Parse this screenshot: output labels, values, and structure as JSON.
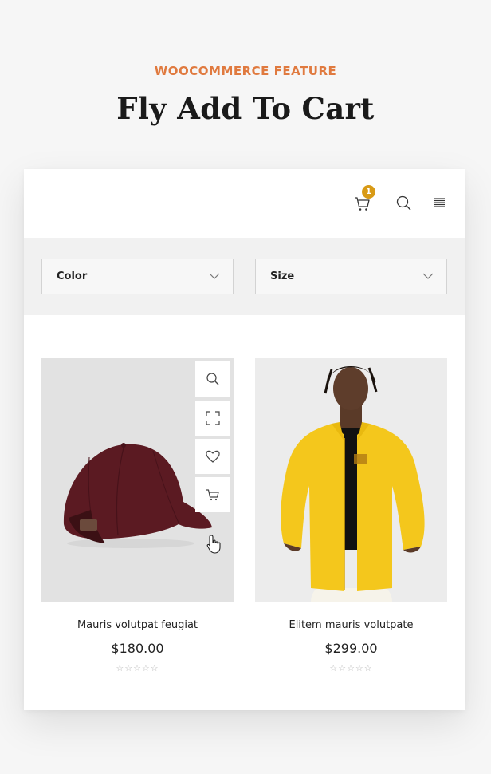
{
  "header": {
    "eyebrow": "WOOCOMMERCE FEATURE",
    "title": "Fly Add To Cart"
  },
  "topbar": {
    "cart_count": "1",
    "icons": [
      "cart-icon",
      "search-icon",
      "menu-icon"
    ]
  },
  "filters": {
    "color_label": "Color",
    "size_label": "Size"
  },
  "products": [
    {
      "name": "Mauris volutpat feugiat",
      "price": "$180.00",
      "rating_stars": "☆☆☆☆☆",
      "image": "maroon-cap",
      "actions": [
        "search-icon",
        "expand-icon",
        "heart-icon",
        "cart-icon"
      ]
    },
    {
      "name": "Elitem mauris volutpate",
      "price": "$299.00",
      "rating_stars": "☆☆☆☆☆",
      "image": "man-in-yellow-jacket"
    }
  ],
  "colors": {
    "accent": "#e07a3f",
    "badge": "#d89a16",
    "cap": "#5b1a22",
    "jacket": "#f4c71c"
  }
}
